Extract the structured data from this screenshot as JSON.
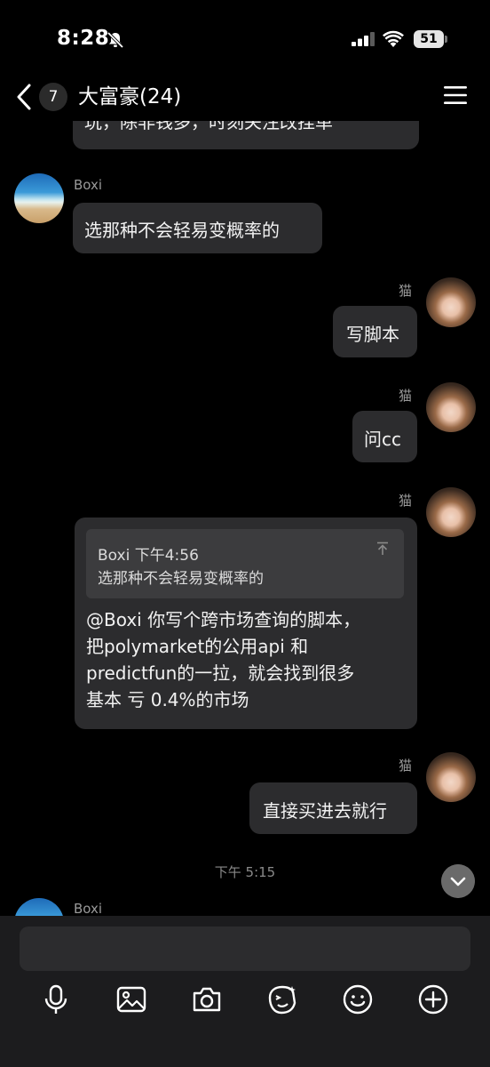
{
  "status_bar": {
    "time": "8:28",
    "battery": "51"
  },
  "nav": {
    "unread_count": "7",
    "title": "大富豪(24)"
  },
  "messages": [
    {
      "id": "partial",
      "text": "玩，除非钱多，时刻关注改挂单"
    },
    {
      "id": "m1",
      "sender": "Boxi",
      "text": "选那种不会轻易变概率的"
    },
    {
      "id": "m2",
      "sender": "猫",
      "text": "写脚本"
    },
    {
      "id": "m3",
      "sender": "猫",
      "text": "问cc"
    },
    {
      "id": "m4",
      "sender": "猫",
      "quote": {
        "author_time": "Boxi 下午4:56",
        "text": "选那种不会轻易变概率的"
      },
      "text": "@Boxi 你写个跨市场查询的脚本，\n把polymarket的公用api 和\npredictfun的一拉，就会找到很多\n基本 亏 0.4%的市场"
    },
    {
      "id": "m5",
      "sender": "猫",
      "text": "直接买进去就行"
    }
  ],
  "time_separator": "下午 5:15",
  "last_sender": "Boxi",
  "icons": {
    "status": [
      "bell-off-icon",
      "signal-icon",
      "wifi-icon",
      "battery-icon"
    ],
    "nav": [
      "back-icon",
      "menu-icon"
    ],
    "toolbar": [
      "mic-icon",
      "image-icon",
      "camera-icon",
      "sticker-icon",
      "emoji-icon",
      "plus-icon"
    ],
    "other": [
      "scroll-down-icon",
      "pin-top-icon"
    ]
  }
}
